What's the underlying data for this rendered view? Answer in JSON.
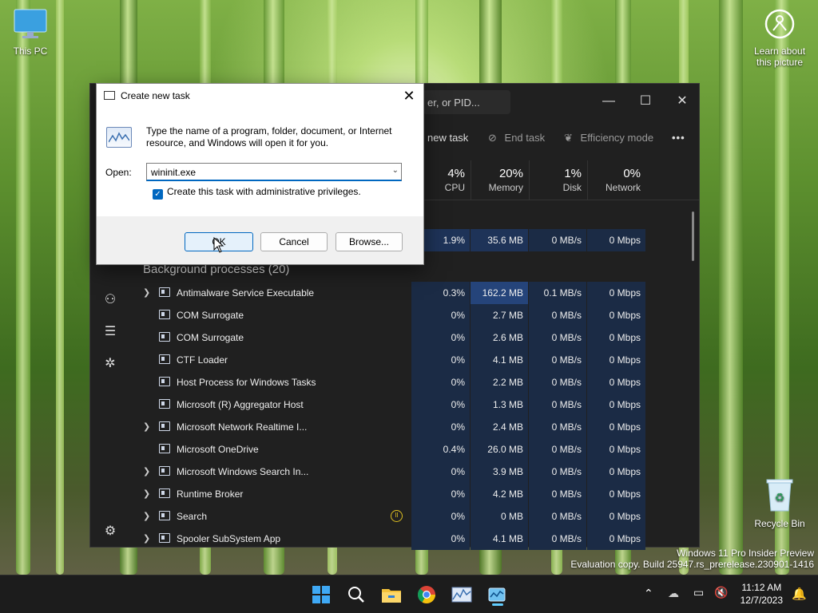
{
  "desktop": {
    "this_pc": "This PC",
    "recycle_bin": "Recycle Bin",
    "learn_about": "Learn about this picture"
  },
  "task_manager": {
    "search_placeholder": "er, or PID...",
    "toolbar": {
      "new_task": "new task",
      "end_task": "End task",
      "efficiency_mode": "Efficiency mode",
      "more": "•••"
    },
    "columns": [
      {
        "pct": "4%",
        "label": "CPU"
      },
      {
        "pct": "20%",
        "label": "Memory"
      },
      {
        "pct": "1%",
        "label": "Disk"
      },
      {
        "pct": "0%",
        "label": "Network"
      }
    ],
    "top_row": {
      "cpu": "1.9%",
      "memory": "35.6 MB",
      "disk": "0 MB/s",
      "network": "0 Mbps"
    },
    "group_header": "Background processes (20)",
    "processes": [
      {
        "name": "Antimalware Service Executable",
        "cpu": "0.3%",
        "memory": "162.2 MB",
        "disk": "0.1 MB/s",
        "network": "0 Mbps",
        "expand": true
      },
      {
        "name": "COM Surrogate",
        "cpu": "0%",
        "memory": "2.7 MB",
        "disk": "0 MB/s",
        "network": "0 Mbps",
        "expand": false
      },
      {
        "name": "COM Surrogate",
        "cpu": "0%",
        "memory": "2.6 MB",
        "disk": "0 MB/s",
        "network": "0 Mbps",
        "expand": false
      },
      {
        "name": "CTF Loader",
        "cpu": "0%",
        "memory": "4.1 MB",
        "disk": "0 MB/s",
        "network": "0 Mbps",
        "expand": false
      },
      {
        "name": "Host Process for Windows Tasks",
        "cpu": "0%",
        "memory": "2.2 MB",
        "disk": "0 MB/s",
        "network": "0 Mbps",
        "expand": false
      },
      {
        "name": "Microsoft (R) Aggregator Host",
        "cpu": "0%",
        "memory": "1.3 MB",
        "disk": "0 MB/s",
        "network": "0 Mbps",
        "expand": false
      },
      {
        "name": "Microsoft Network Realtime I...",
        "cpu": "0%",
        "memory": "2.4 MB",
        "disk": "0 MB/s",
        "network": "0 Mbps",
        "expand": true
      },
      {
        "name": "Microsoft OneDrive",
        "cpu": "0.4%",
        "memory": "26.0 MB",
        "disk": "0 MB/s",
        "network": "0 Mbps",
        "expand": false
      },
      {
        "name": "Microsoft Windows Search In...",
        "cpu": "0%",
        "memory": "3.9 MB",
        "disk": "0 MB/s",
        "network": "0 Mbps",
        "expand": true
      },
      {
        "name": "Runtime Broker",
        "cpu": "0%",
        "memory": "4.2 MB",
        "disk": "0 MB/s",
        "network": "0 Mbps",
        "expand": true
      },
      {
        "name": "Search",
        "cpu": "0%",
        "memory": "0 MB",
        "disk": "0 MB/s",
        "network": "0 Mbps",
        "expand": true
      },
      {
        "name": "Spooler SubSystem App",
        "cpu": "0%",
        "memory": "4.1 MB",
        "disk": "0 MB/s",
        "network": "0 Mbps",
        "expand": true
      }
    ]
  },
  "dialog": {
    "title": "Create new task",
    "description": "Type the name of a program, folder, document, or Internet resource, and Windows will open it for you.",
    "open_label": "Open:",
    "open_value": "wininit.exe",
    "admin_checkbox": "Create this task with administrative privileges.",
    "ok": "OK",
    "cancel": "Cancel",
    "browse": "Browse..."
  },
  "watermark": {
    "line1": "Windows 11 Pro Insider Preview",
    "line2": "Evaluation copy. Build 25947.rs_prerelease.230901-1416"
  },
  "taskbar": {
    "time": "11:12 AM",
    "date": "12/7/2023"
  },
  "colors": {
    "accent": "#0067c0",
    "tm_bg": "#202020",
    "taskbar_bg": "#1c1c1c"
  }
}
